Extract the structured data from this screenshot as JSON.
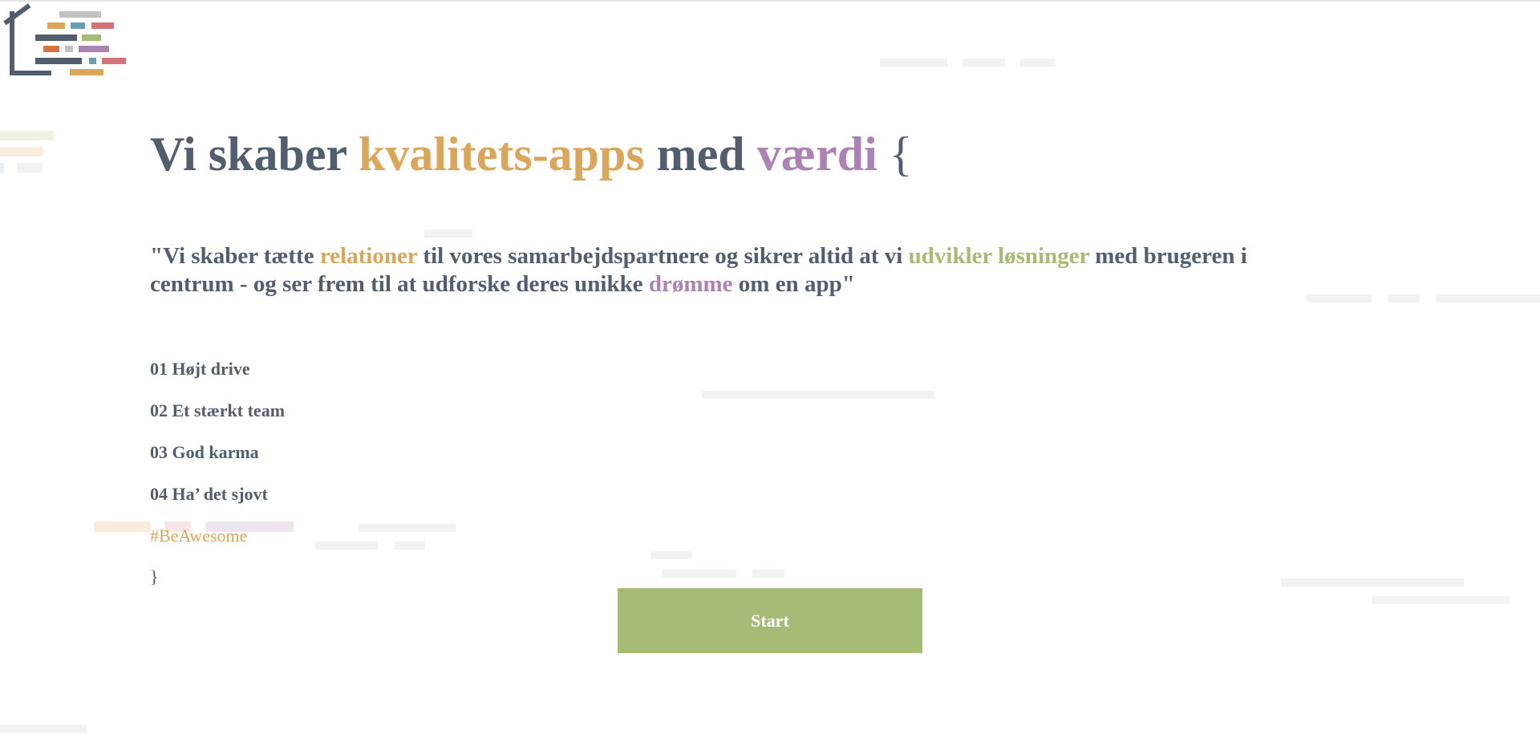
{
  "colors": {
    "text": "#525e6e",
    "orange": "#dba65a",
    "purple": "#ab82b3",
    "green": "#a6bb76",
    "red": "#d4727a",
    "blue": "#6a9fb3",
    "gray": "#c2c2c2",
    "darkorange": "#d7743f"
  },
  "hero": {
    "title_part1": "Vi skaber ",
    "title_highlight1": "kvalitets-apps",
    "title_part2": " med ",
    "title_highlight2": "værdi",
    "title_brace": " {"
  },
  "quote": {
    "part1": "\"Vi skaber tætte ",
    "highlight1": "relationer",
    "part2": " til vores samarbejdspartnere og sikrer altid at vi ",
    "highlight2": "udvikler løsninger",
    "part3": " med brugeren i centrum - og ser frem til at udforske deres unikke ",
    "highlight3": "drømme",
    "part4": " om en app\""
  },
  "values": [
    "01 Højt drive",
    "02 Et stærkt team",
    "03 God karma",
    "04 Ha’ det sjovt"
  ],
  "hashtag": "#BeAwesome",
  "closing_brace": "}",
  "start_button": "Start"
}
